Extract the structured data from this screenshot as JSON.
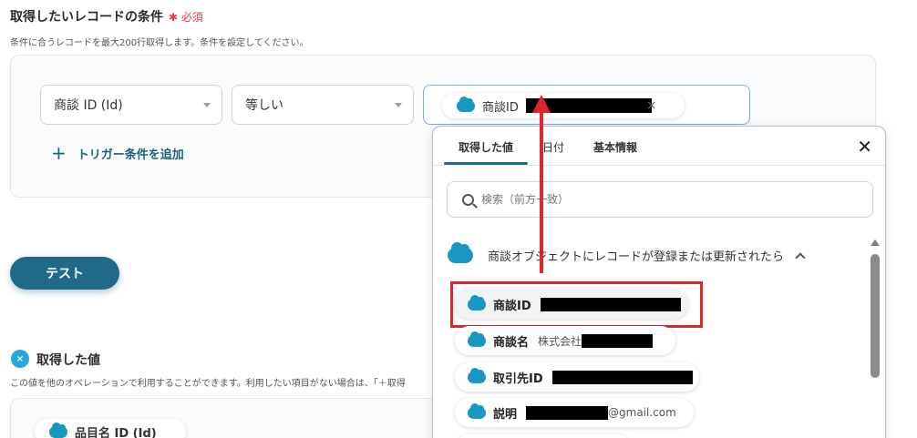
{
  "section": {
    "title": "取得したいレコードの条件",
    "required_label": "✱ 必須",
    "description": "条件に合うレコードを最大200行取得します。条件を設定してください。"
  },
  "condition": {
    "field_value": "商談 ID (Id)",
    "operator_value": "等しい",
    "chip_label": "商談ID",
    "chip_close": "×"
  },
  "add_trigger": {
    "icon": "+",
    "label": "トリガー条件を追加"
  },
  "test_button": {
    "label": "テスト"
  },
  "got_values": {
    "icon": "×",
    "title": "取得した値",
    "description": "この値を他のオペレーションで利用することができます。利用したい項目がない場合は、「＋取得",
    "first_chip": "品目名 ID (Id)"
  },
  "popup": {
    "tabs": [
      "取得した値",
      "日付",
      "基本情報"
    ],
    "active_tab": 0,
    "close_icon": "✕",
    "search_placeholder": "検索（前方一致）",
    "group_title": "商談オブジェクトにレコードが登録または更新されたら",
    "items": [
      {
        "label": "商談ID",
        "value": ""
      },
      {
        "label": "商談名",
        "value": "株式会社"
      },
      {
        "label": "取引先ID",
        "value": ""
      },
      {
        "label": "説明",
        "value": "@gmail.com"
      }
    ]
  },
  "colors": {
    "accent": "#1f6a88",
    "brand_cloud": "#1798c1",
    "highlight": "#e0262c"
  },
  "icons": {
    "salesforce": "cloud-icon",
    "search": "search-icon",
    "close": "close-icon",
    "collapse": "chevron-up-icon",
    "add": "plus-icon"
  }
}
